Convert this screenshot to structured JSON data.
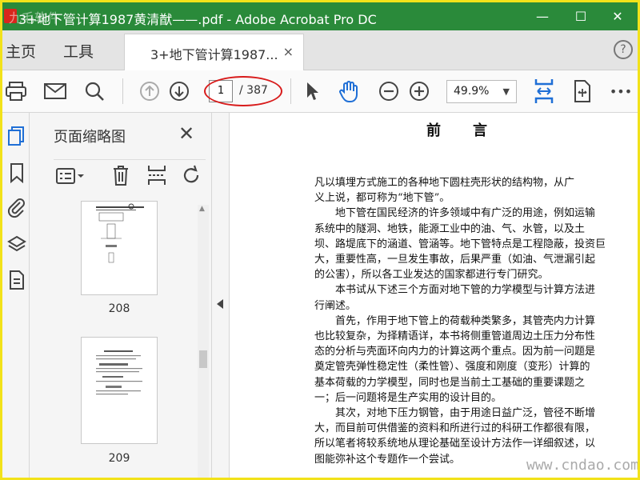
{
  "window": {
    "title": "3+地下管计算1987黄清猷——.pdf - Adobe Acrobat Pro DC",
    "watermark_top": "九毛软件",
    "minimize": "—",
    "maximize": "☐",
    "close": "✕"
  },
  "tabs": {
    "home": "主页",
    "tools": "工具",
    "doc_tab": "3+地下管计算1987...",
    "doc_tab_close": "×",
    "help": "?"
  },
  "toolbar": {
    "current_page": "1",
    "total_pages": "/ 387",
    "zoom": "49.9%",
    "zoom_arrow": "▼",
    "more": "•••",
    "icons": [
      "print-icon",
      "email-icon",
      "search-icon",
      "page-up-icon",
      "page-down-icon",
      "select-cursor-icon",
      "hand-tool-icon",
      "zoom-out-icon",
      "zoom-in-icon",
      "fit-width-icon",
      "rotate-view-icon",
      "more-icon"
    ]
  },
  "left_rail": {
    "icons": [
      "page-thumbnails-icon",
      "bookmarks-icon",
      "attachments-icon",
      "layers-icon",
      "document-properties-icon"
    ]
  },
  "thumbnail_panel": {
    "title": "页面缩略图",
    "close": "✕",
    "thumbnails": [
      {
        "page": "208"
      },
      {
        "page": "209"
      }
    ]
  },
  "document": {
    "heading": "前言",
    "lines": [
      "凡以填埋方式施工的各种地下圆柱壳形状的结构物，从广",
      "义上说，都可称为“地下管”。",
      "　　地下管在国民经济的许多领域中有广泛的用途，例如运输",
      "系统中的隧洞、地铁，能源工业中的油、气、水管，以及土",
      "坝、路堤底下的涵道、管涵等。地下管特点是工程隐蔽，投资巨",
      "大，重要性高，一旦发生事故，后果严重（如油、气泄漏引起",
      "的公害），所以各工业发达的国家都进行专门研究。",
      "　　本书试从下述三个方面对地下管的力学模型与计算方法进",
      "行阐述。",
      "　　首先，作用于地下管上的荷载种类繁多，其管壳内力计算",
      "也比较复杂，为择精语详，本书将侧重管道周边土压力分布性",
      "态的分析与壳面环向内力的计算这两个重点。因为前一问题是",
      "奠定管壳弹性稳定性（柔性管）、强度和刚度（变形）计算的",
      "基本荷载的力学模型，同时也是当前土工基础的重要课题之",
      "一；后一问题将是生产实用的设计目的。",
      "　　其次，对地下压力钢管，由于用途日益广泛，管径不断增",
      "大，而目前可供借鉴的资料和所进行过的科研工作都很有限，",
      "所以笔者将较系统地从理论基础至设计方法作一详细叙述，以",
      "图能弥补这个专题作一个尝试。"
    ],
    "watermark": "www.cndao.com"
  }
}
